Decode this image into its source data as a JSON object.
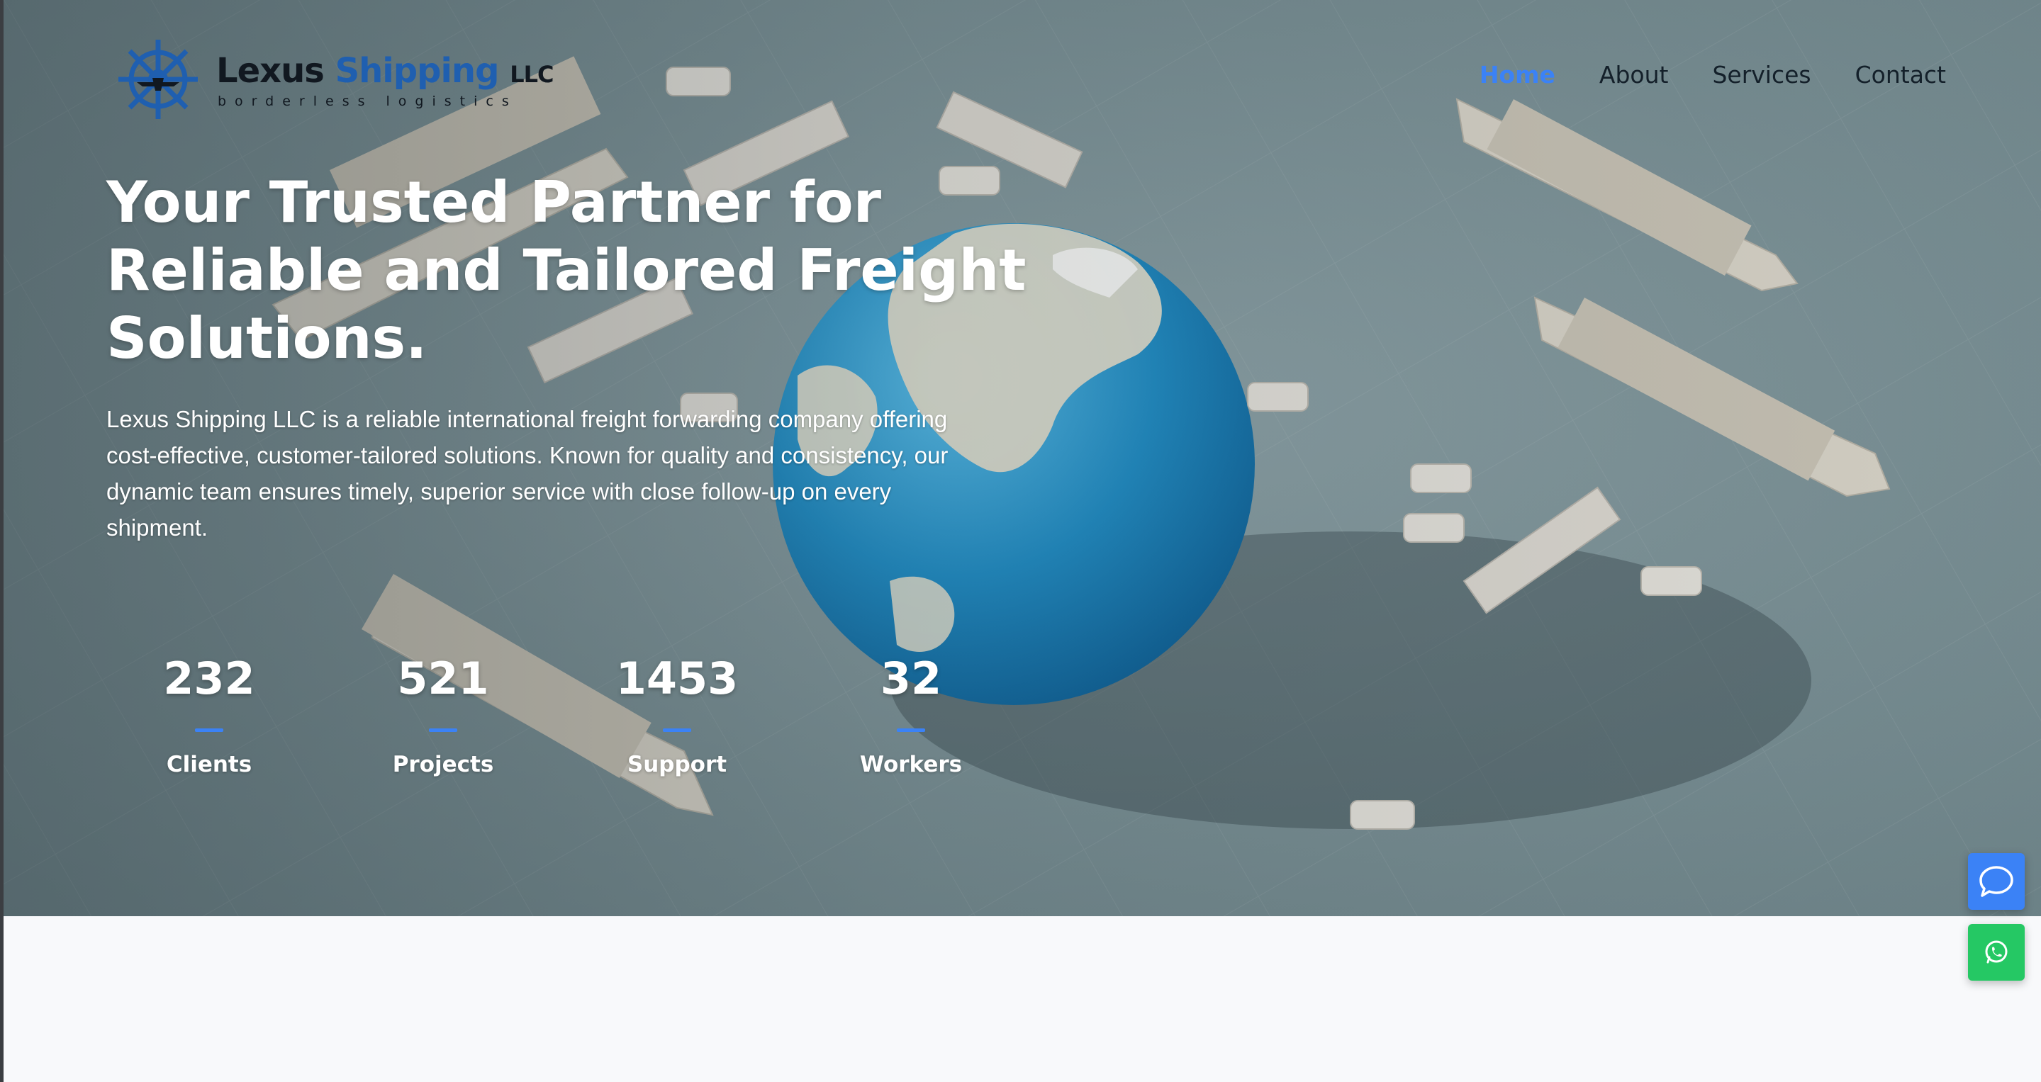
{
  "brand": {
    "name_main": "Lexus ",
    "name_accent": "Shipping",
    "name_suffix": "LLC",
    "tagline": "borderless logistics",
    "accent_color": "#1f5fb0"
  },
  "nav": {
    "items": [
      {
        "label": "Home",
        "active": true
      },
      {
        "label": "About",
        "active": false
      },
      {
        "label": "Services",
        "active": false
      },
      {
        "label": "Contact",
        "active": false
      }
    ],
    "active_color": "#3b82f6"
  },
  "hero": {
    "headline": "Your Trusted Partner for Reliable and Tailored Freight Solutions.",
    "lead": "Lexus Shipping LLC is a reliable international freight forwarding company offering cost-effective, customer-tailored solutions. Known for quality and consistency, our dynamic team ensures timely, superior service with close follow-up on every shipment."
  },
  "stats": [
    {
      "value": "232",
      "label": "Clients"
    },
    {
      "value": "521",
      "label": "Projects"
    },
    {
      "value": "1453",
      "label": "Support"
    },
    {
      "value": "32",
      "label": "Workers"
    }
  ],
  "floating_actions": {
    "chat": {
      "icon": "chat-bubble-icon",
      "color": "#3b82f6"
    },
    "whatsapp": {
      "icon": "whatsapp-icon",
      "color": "#25c864"
    }
  }
}
